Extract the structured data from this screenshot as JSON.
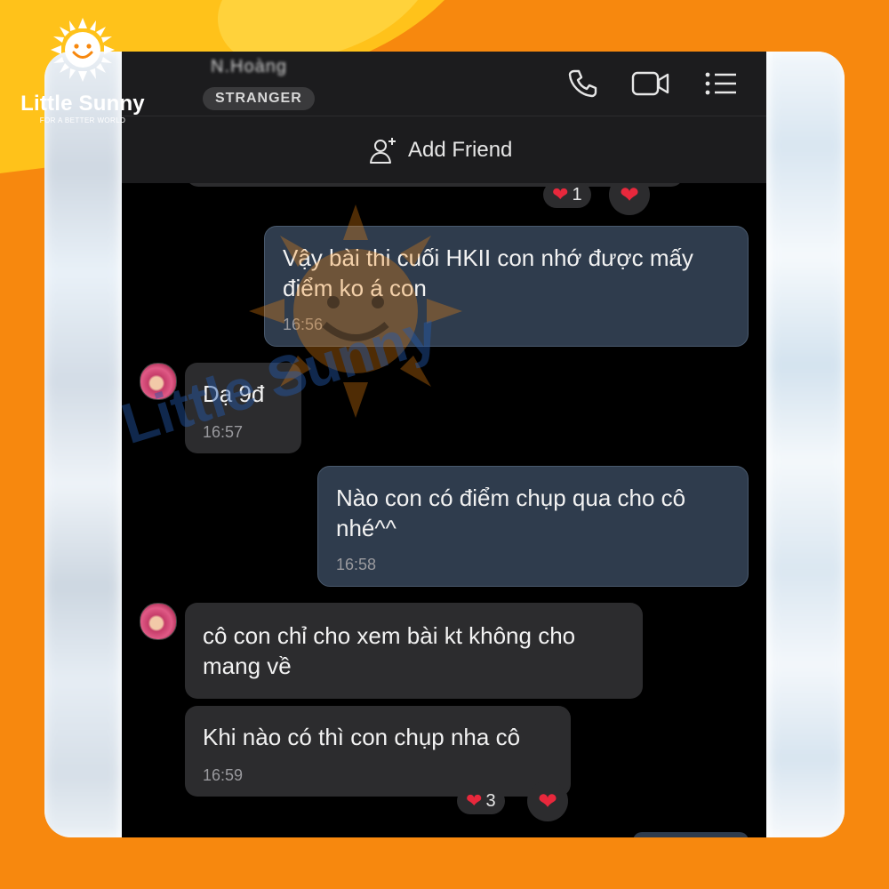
{
  "brand": {
    "name": "Little Sunny",
    "tagline": "FOR A BETTER WORLD"
  },
  "header": {
    "contact_name": "N.Hoàng",
    "badge": "STRANGER",
    "icons": [
      "phone-icon",
      "video-call-icon",
      "menu-list-icon"
    ],
    "add_friend_label": "Add Friend"
  },
  "reactions_top": {
    "count": "1"
  },
  "messages": [
    {
      "direction": "out",
      "text": "Vậy bài thi cuối HKII con nhớ được mấy điểm ko á con",
      "time": "16:56"
    },
    {
      "direction": "in",
      "text": "Dạ 9đ",
      "time": "16:57"
    },
    {
      "direction": "out",
      "text": "Nào con có điểm chụp qua cho cô nhé^^",
      "time": "16:58"
    },
    {
      "direction": "in",
      "text": "cô con chỉ cho xem bài kt không cho mang về",
      "time": ""
    },
    {
      "direction": "in",
      "text": "Khi nào có thì con chụp nha cô",
      "time": "16:59"
    }
  ],
  "reactions_bottom": {
    "count": "3"
  },
  "watermark": "Little Sunny",
  "colors": {
    "background": "#f7880e",
    "splash": "#ffc21a",
    "outgoing_bubble": "#2f3c4d",
    "incoming_bubble": "#2c2c2e",
    "heart": "#e8283c"
  }
}
